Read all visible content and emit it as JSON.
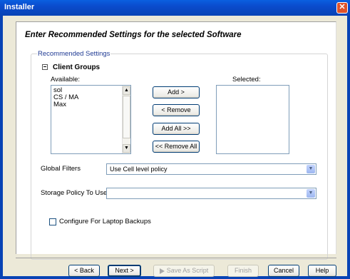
{
  "window": {
    "title": "Installer",
    "close_glyph": "✕"
  },
  "page": {
    "heading": "Enter Recommended Settings for the selected Software"
  },
  "settings": {
    "legend": "Recommended Settings",
    "section_title": "Client Groups",
    "available_label": "Available:",
    "selected_label": "Selected:",
    "available_items": [
      "sol",
      "CS / MA",
      "Max"
    ],
    "selected_items": [],
    "buttons": {
      "add": "Add >",
      "remove": "< Remove",
      "add_all": "Add All >>",
      "remove_all": "<< Remove All"
    },
    "global_filters_label": "Global Filters",
    "global_filters_value": "Use Cell level policy",
    "storage_policy_label": "Storage Policy To Use",
    "storage_policy_value": "",
    "laptop_backups_label": "Configure For Laptop Backups",
    "laptop_backups_checked": false
  },
  "footer": {
    "back": "< Back",
    "next": "Next >",
    "save_as_script": "Save As Script",
    "finish": "Finish",
    "cancel": "Cancel",
    "help": "Help"
  },
  "icons": {
    "collapse": "minus-box-icon",
    "dropdown": "chevron-down-icon",
    "script": "play-icon"
  }
}
